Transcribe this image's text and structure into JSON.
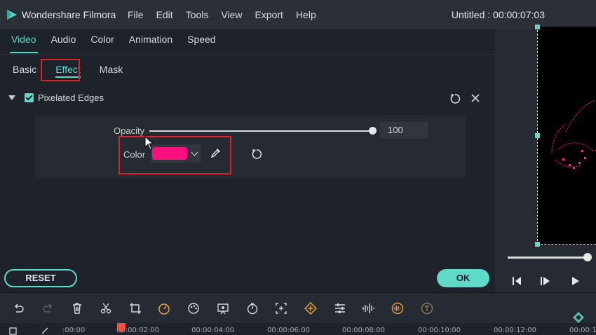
{
  "titlebar": {
    "app_name": "Wondershare Filmora",
    "menu": [
      "File",
      "Edit",
      "Tools",
      "View",
      "Export",
      "Help"
    ],
    "project": "Untitled : 00:00:07:03"
  },
  "tabs": [
    "Video",
    "Audio",
    "Color",
    "Animation",
    "Speed"
  ],
  "active_tab": "Video",
  "subtabs": [
    "Basic",
    "Effect",
    "Mask"
  ],
  "active_subtab": "Effect",
  "effect": {
    "name": "Pixelated Edges",
    "enabled": true,
    "opacity_label": "Opacity",
    "opacity_value": "100",
    "opacity_level": 100,
    "color_label": "Color",
    "color_value": "#ff0f7d"
  },
  "buttons": {
    "reset": "RESET",
    "ok": "OK"
  },
  "preview": {
    "progress": 0.95
  },
  "toolbar_icons": [
    "undo-icon",
    "redo-icon",
    "delete-icon",
    "cut-icon",
    "crop-icon",
    "speed-icon",
    "color-icon",
    "green-screen-icon",
    "duration-icon",
    "zoom-icon",
    "keyframe-icon",
    "adjust-icon",
    "audio-icon",
    "voice-icon",
    "text-to-speech-icon"
  ],
  "timeline_ticks": [
    ":00:00",
    "00:00:02:00",
    "00:00:04:00",
    "00:00:06:00",
    "00:00:08:00",
    "00:00:10:00",
    "00:00:12:00",
    "00:00:1"
  ],
  "colors": {
    "accent": "#5fd9c8",
    "highlight_box": "#d3222a",
    "background": "#1e222a"
  }
}
